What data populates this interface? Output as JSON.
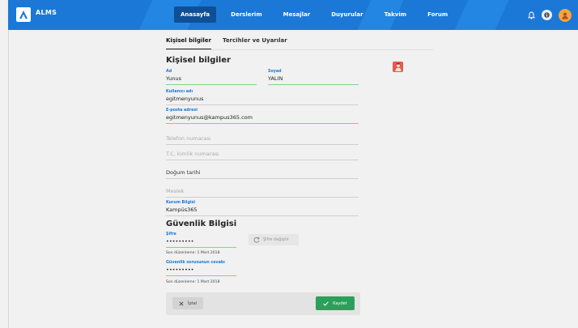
{
  "header": {
    "brand": "ALMS",
    "nav": [
      "Anasayfa",
      "Derslerim",
      "Mesajlar",
      "Duyurular",
      "Takvim",
      "Forum"
    ],
    "active_nav": "Anasayfa"
  },
  "tabs": [
    "Kişisel bilgiler",
    "Tercihler ve Uyarılar"
  ],
  "personal": {
    "title": "Kişisel bilgiler",
    "first_name": {
      "label": "Ad",
      "value": "Yunus"
    },
    "last_name": {
      "label": "Soyad",
      "value": "YALIN"
    },
    "username": {
      "label": "Kullanıcı adı",
      "value": "egitmenyunus"
    },
    "email": {
      "label": "E-posta adresi",
      "value": "egitmenyunus@kampus365.com"
    },
    "phone": {
      "placeholder": "Telefon numarası"
    },
    "tc": {
      "placeholder": "T.C. kimlik numarası"
    },
    "birth": {
      "placeholder": "Doğum tarihi"
    },
    "job": {
      "placeholder": "Meslek"
    },
    "org": {
      "label": "Kurum Bilgisi",
      "value": "Kampüs365"
    }
  },
  "security": {
    "title": "Güvenlik Bilgisi",
    "password": {
      "label": "Şifre",
      "value": "•••••••••"
    },
    "change_password": "Şifre değiştir",
    "pw_modified": "Son düzenleme: 1 Mart 2018",
    "answer": {
      "label": "Güvenlik sorusunun cevabı",
      "value": "•••••••••"
    },
    "answer_modified": "Son düzenleme: 1 Mart 2018"
  },
  "actions": {
    "cancel": "İptal",
    "save": "Kaydet"
  },
  "colors": {
    "primary": "#1b78d6",
    "success": "#2aa05a",
    "underline_active": "#7fd58b"
  }
}
